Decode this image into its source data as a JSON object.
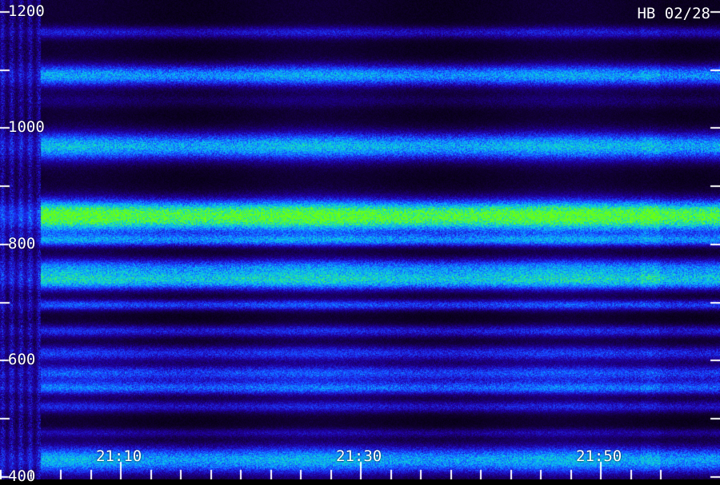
{
  "chart_data": {
    "type": "heatmap",
    "label": "HB 02/28",
    "y_ticks": [
      400,
      600,
      800,
      1000,
      1200
    ],
    "y_minor_ticks": [
      500,
      700,
      900,
      1100
    ],
    "ylim": [
      300,
      1250
    ],
    "x_ticks": [
      "21:10",
      "21:30",
      "21:50"
    ],
    "x_tick_minutes": [
      10,
      30,
      50
    ],
    "xlim_minutes": [
      2,
      55
    ],
    "x_minor_step_minutes": 2.5,
    "gap_end_minute": 3.4,
    "bands": [
      {
        "center": 1164,
        "width": 8,
        "intensity": 0.28
      },
      {
        "center": 1090,
        "width": 14,
        "intensity": 0.55
      },
      {
        "center": 1046,
        "width": 9,
        "intensity": 0.12
      },
      {
        "center": 968,
        "width": 18,
        "intensity": 0.6
      },
      {
        "center": 848,
        "width": 20,
        "intensity": 0.95
      },
      {
        "center": 806,
        "width": 8,
        "intensity": 0.45
      },
      {
        "center": 760,
        "width": 12,
        "intensity": 0.45
      },
      {
        "center": 736,
        "width": 12,
        "intensity": 0.6
      },
      {
        "center": 695,
        "width": 7,
        "intensity": 0.4
      },
      {
        "center": 650,
        "width": 8,
        "intensity": 0.32
      },
      {
        "center": 612,
        "width": 10,
        "intensity": 0.35
      },
      {
        "center": 578,
        "width": 10,
        "intensity": 0.4
      },
      {
        "center": 552,
        "width": 9,
        "intensity": 0.45
      },
      {
        "center": 520,
        "width": 8,
        "intensity": 0.3
      },
      {
        "center": 475,
        "width": 6,
        "intensity": 0.2
      },
      {
        "center": 428,
        "width": 18,
        "intensity": 0.58
      }
    ],
    "colormap": [
      "#000000",
      "#120038",
      "#2000a0",
      "#1a3cff",
      "#0aa8ff",
      "#12e0c0",
      "#6cff10"
    ]
  }
}
